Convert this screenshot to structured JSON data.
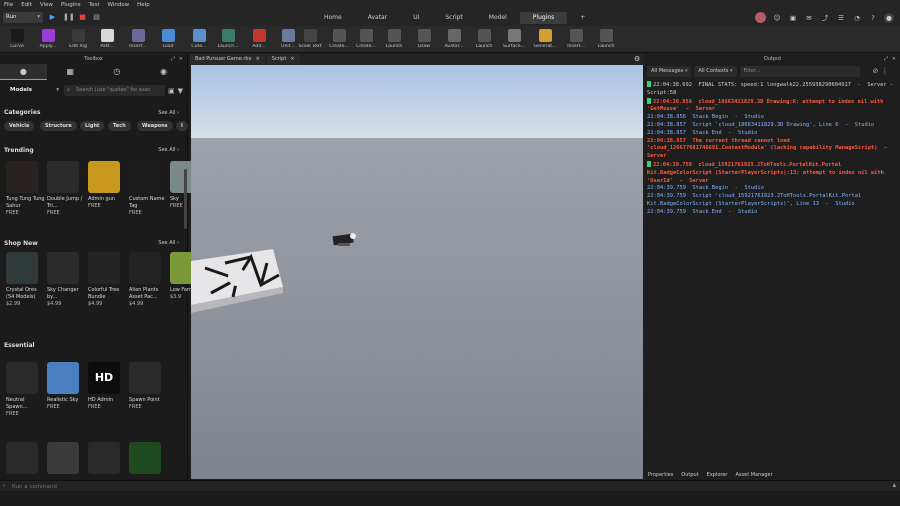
{
  "menubar": [
    "File",
    "Edit",
    "View",
    "Plugins",
    "Test",
    "Window",
    "Help"
  ],
  "run_mode": "Run",
  "nav_tabs": [
    "Home",
    "Avatar",
    "UI",
    "Script",
    "Model",
    "Plugins",
    "+"
  ],
  "ribbon": [
    {
      "label": "Curve",
      "icon": "curve-icon",
      "color": "#1b1b1b"
    },
    {
      "label": "Apply...",
      "icon": "apply-icon",
      "color": "#9b3bd8"
    },
    {
      "label": "Edit Rig",
      "icon": "edit-rig-icon",
      "color": "#3a3a3a"
    },
    {
      "label": "Patt...",
      "icon": "pattern-icon",
      "color": "#d9d9d9"
    },
    {
      "label": "Insert...",
      "icon": "insert-icon",
      "color": "#6a6a9a"
    },
    {
      "label": "Load",
      "icon": "load-icon",
      "color": "#4a8bd6"
    },
    {
      "label": "Cute...",
      "icon": "cute-icon",
      "color": "#5a8fd0"
    },
    {
      "label": "Launch...",
      "icon": "launch-icon",
      "color": "#3a7a6a"
    },
    {
      "label": "Add...",
      "icon": "add-icon",
      "color": "#c0392b"
    },
    {
      "label": "Unit...",
      "icon": "unit-icon",
      "color": "#6a7a9a"
    },
    {
      "label": "Scale Text",
      "icon": "scale-text-icon",
      "color": "#444"
    },
    {
      "label": "Create...",
      "icon": "create-icon",
      "color": "#555"
    },
    {
      "label": "Create...",
      "icon": "create-2-icon",
      "color": "#555"
    },
    {
      "label": "Launch",
      "icon": "launch-2-icon",
      "color": "#555"
    },
    {
      "label": "Draw",
      "icon": "draw-icon",
      "color": "#555"
    },
    {
      "label": "Avatar...",
      "icon": "avatar-tool-icon",
      "color": "#666"
    },
    {
      "label": "Launch",
      "icon": "launch-3-icon",
      "color": "#555"
    },
    {
      "label": "Surface...",
      "icon": "surface-icon",
      "color": "#777"
    },
    {
      "label": "Generat...",
      "icon": "generate-icon",
      "color": "#d0a030"
    },
    {
      "label": "Insert...",
      "icon": "insert-2-icon",
      "color": "#555"
    },
    {
      "label": "Launch",
      "icon": "launch-4-icon",
      "color": "#555"
    }
  ],
  "toolbox": {
    "title": "Toolbox",
    "category_select": "Models",
    "search_placeholder": "Search (use \"quotes\" for exac",
    "see_all": "See All",
    "categories_heading": "Categories",
    "chips": [
      "Vehicle",
      "Structure",
      "Light",
      "Tech",
      "Weapons",
      "I"
    ],
    "trending_heading": "Trending",
    "trending": [
      {
        "name": "Tung Tung Tung Sahur",
        "price": "FREE",
        "thumb": "#2a2220"
      },
      {
        "name": "Double Jump / Tri...",
        "price": "FREE",
        "thumb": "#2b2b2b"
      },
      {
        "name": "Admin gun",
        "price": "FREE",
        "thumb": "#c9961e"
      },
      {
        "name": "Custom Name Tag",
        "price": "FREE",
        "thumb": "#1d1d1d"
      },
      {
        "name": "Sky",
        "price": "FREE",
        "thumb": "#7a8a8a"
      }
    ],
    "shopnew_heading": "Shop New",
    "shopnew": [
      {
        "name": "Crystal Ores (54 Models)",
        "price": "$2.99",
        "thumb": "#2e3b3a"
      },
      {
        "name": "Sky Changer by...",
        "price": "$4.99",
        "thumb": "#2b2b2b"
      },
      {
        "name": "Colorful Tree Bundle",
        "price": "$4.99",
        "thumb": "#242424"
      },
      {
        "name": "Alien Plants Asset Pac...",
        "price": "$4.99",
        "thumb": "#222"
      },
      {
        "name": "Low Farm",
        "price": "$3.9",
        "thumb": "#7a9a3a"
      }
    ],
    "essential_heading": "Essential",
    "essential": [
      {
        "name": "Neutral Spawn...",
        "price": "FREE",
        "thumb": "#2a2a2a"
      },
      {
        "name": "Realistic Sky",
        "price": "FREE",
        "thumb": "#4a7fc0"
      },
      {
        "name": "HD Admin",
        "price": "FREE",
        "thumb": "#0d0d0d",
        "glyph": "HD"
      },
      {
        "name": "Spawn Point",
        "price": "FREE",
        "thumb": "#2a2a2a"
      }
    ],
    "more": [
      {
        "thumb": "#2a2a2a"
      },
      {
        "thumb": "#3a3a3a"
      },
      {
        "thumb": "#2a2a2a"
      },
      {
        "thumb": "#1f4a1f"
      }
    ]
  },
  "editor_tabs": [
    {
      "label": "Bad Pursuer Game.rbx"
    },
    {
      "label": "Script"
    }
  ],
  "output": {
    "title": "Output",
    "filter_messages": "All Messages",
    "filter_contexts": "All Contexts",
    "filter_placeholder": "Filter...",
    "lines": [
      {
        "text": "22:04:38.692  FINAL STATS: speed:1 longwalk22.255938290604917  -  Server - Script:58",
        "kind": "normal",
        "marker": true
      },
      {
        "text": "22:04:38.856  cloud_18663411829.3D Drawing:6: attempt to index nil with 'GetMouse'  -  Server",
        "kind": "err",
        "marker": true
      },
      {
        "text": "22:04:38.856  Stack Begin  -  Studio",
        "kind": "info",
        "marker": false
      },
      {
        "text": "22:04:38.857  Script 'cloud_18663411829.3D Drawing', Line 6  -  Studio",
        "kind": "info",
        "marker": false
      },
      {
        "text": "22:04:38.857  Stack End  -  Studio",
        "kind": "info",
        "marker": false
      },
      {
        "text": "22:04:38.857  The current thread cannot load 'cloud_126677681746691.ContextModule' (lacking capability ManageScript)  -  Server",
        "kind": "err",
        "marker": false
      },
      {
        "text": "22:04:39.758  cloud_15921761923.JToHTools.PortalKit.Portal Kit.BadgeColorScript (StarterPlayerScripts):13: attempt to index nil with 'UserId'  -  Server",
        "kind": "err",
        "marker": true
      },
      {
        "text": "22:04:39.759  Stack Begin  -  Studio",
        "kind": "info",
        "marker": false
      },
      {
        "text": "22:04:39.759  Script 'cloud_15921761923.JToHTools.PortalKit.Portal Kit.BadgeColorScript (StarterPlayerScripts)', Line 13  -  Studio",
        "kind": "info",
        "marker": false
      },
      {
        "text": "22:04:39.759  Stack End  -  Studio",
        "kind": "info",
        "marker": false
      }
    ],
    "bottom_tabs": [
      "Properties",
      "Output",
      "Explorer",
      "Asset Manager"
    ]
  },
  "command_bar": {
    "placeholder": "Run a command"
  }
}
